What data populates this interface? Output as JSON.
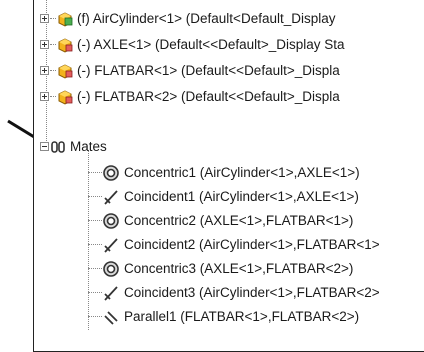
{
  "components": [
    {
      "name": "(f) AirCylinder<1> (Default<Default_Display",
      "icon": "part-fixed-icon"
    },
    {
      "name": "(-) AXLE<1> (Default<<Default>_Display Sta",
      "icon": "part-icon"
    },
    {
      "name": "(-) FLATBAR<1> (Default<<Default>_Displa",
      "icon": "part-icon"
    },
    {
      "name": "(-) FLATBAR<2> (Default<<Default>_Displa",
      "icon": "part-icon"
    }
  ],
  "mates_folder": {
    "label": "Mates",
    "icon": "mates-folder-icon"
  },
  "mates": [
    {
      "label": "Concentric1 (AirCylinder<1>,AXLE<1>)",
      "icon": "concentric-icon"
    },
    {
      "label": "Coincident1 (AirCylinder<1>,AXLE<1>)",
      "icon": "coincident-icon"
    },
    {
      "label": "Concentric2 (AXLE<1>,FLATBAR<1>)",
      "icon": "concentric-icon"
    },
    {
      "label": "Coincident2 (AirCylinder<1>,FLATBAR<1>",
      "icon": "coincident-icon"
    },
    {
      "label": "Concentric3 (AXLE<1>,FLATBAR<2>)",
      "icon": "concentric-icon"
    },
    {
      "label": "Coincident3 (AirCylinder<1>,FLATBAR<2>",
      "icon": "coincident-icon"
    },
    {
      "label": "Parallel1 (FLATBAR<1>,FLATBAR<2>)",
      "icon": "parallel-icon"
    }
  ]
}
